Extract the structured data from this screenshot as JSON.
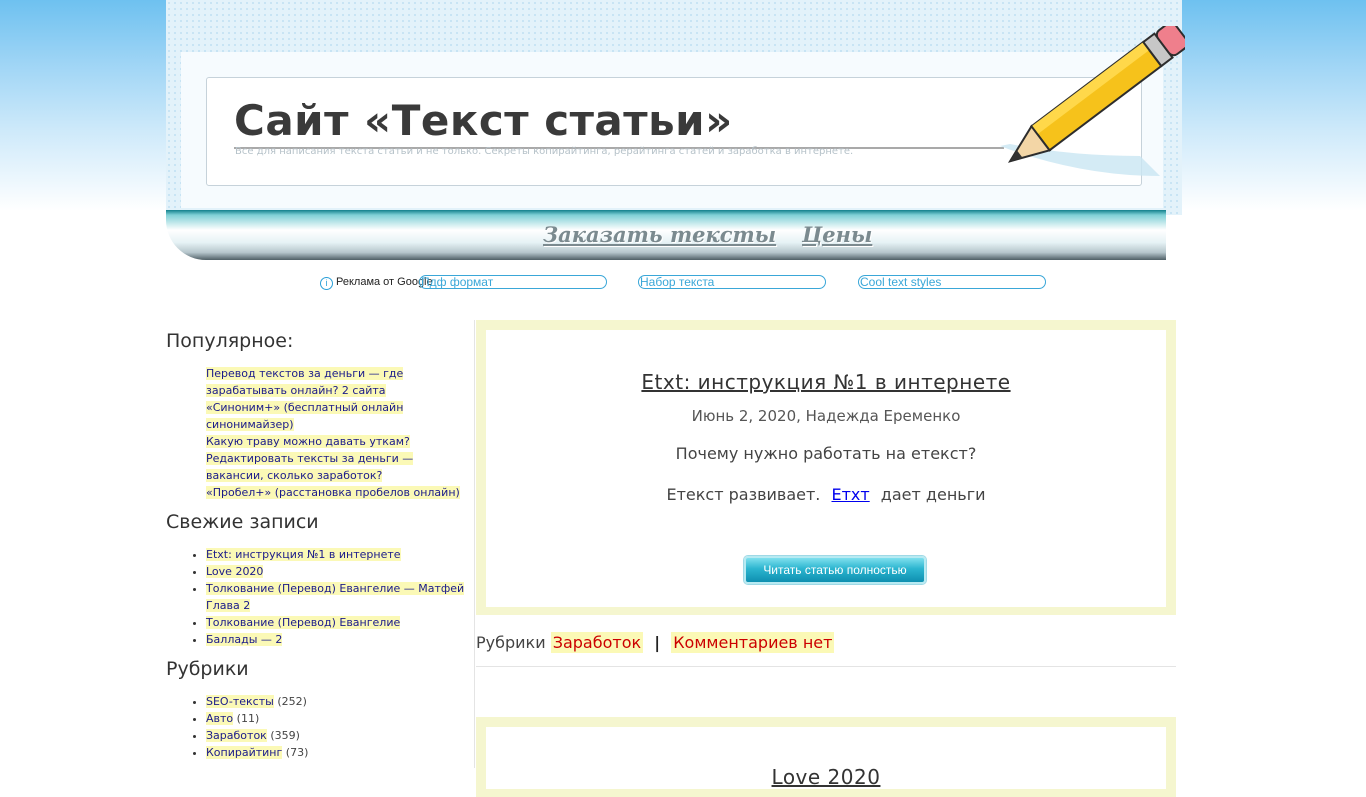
{
  "header": {
    "site_title": "Сайт «Текст статьи»",
    "tagline": "Все для написания текста статьи и не только. Секреты копирайтинга, рерайтинга статей и заработка в интернете.",
    "logo_icon": "pencil-icon"
  },
  "nav": {
    "order_texts": "Заказать тексты",
    "prices": "Цены"
  },
  "ads": {
    "label": "Реклама от Google",
    "info_icon": "info-icon",
    "links": [
      "Пдф формат",
      "Набор текста",
      "Cool text styles"
    ]
  },
  "sidebar": {
    "popular": {
      "title": "Популярное:",
      "items": [
        "Перевод текстов за деньги — где зарабатывать онлайн? 2 сайта",
        "«Синоним+» (бесплатный онлайн синонимайзер)",
        "Какую траву можно давать уткам?",
        "Редактировать тексты за деньги — вакансии, сколько заработок?",
        "«Пробел+» (расстановка пробелов онлайн)"
      ]
    },
    "recent": {
      "title": "Свежие записи",
      "items": [
        "Etxt: инструкция №1 в интернете",
        "Love 2020",
        "Толкование (Перевод) Евангелие — Матфей Глава 2",
        "Толкование (Перевод) Евангелие",
        "Баллады — 2"
      ]
    },
    "categories": {
      "title": "Рубрики",
      "items": [
        {
          "name": "SEO-тексты",
          "count": "(252)"
        },
        {
          "name": "Авто",
          "count": "(11)"
        },
        {
          "name": "Заработок",
          "count": "(359)"
        },
        {
          "name": "Копирайтинг",
          "count": "(73)"
        }
      ]
    }
  },
  "posts": [
    {
      "title": "Etxt: инструкция №1 в интернете",
      "meta": "Июнь 2, 2020, Надежда Еременко",
      "line1": "Почему нужно работать на етекст?",
      "line2_before": "Етекст развивает.",
      "line2_link": "Етхт",
      "line2_after": "дает деньги",
      "read_more": "Читать статью полностью"
    },
    {
      "title": "Love 2020"
    }
  ],
  "post_footer": {
    "label": "Рубрики",
    "category": "Заработок",
    "separator": "|",
    "comments": "Комментариев нет"
  },
  "colors": {
    "accent_yellow": "#f5f6cf",
    "tag_highlight": "#fbf9b6",
    "button_teal": "#2bb5cf",
    "tag_red": "#cc0000"
  }
}
